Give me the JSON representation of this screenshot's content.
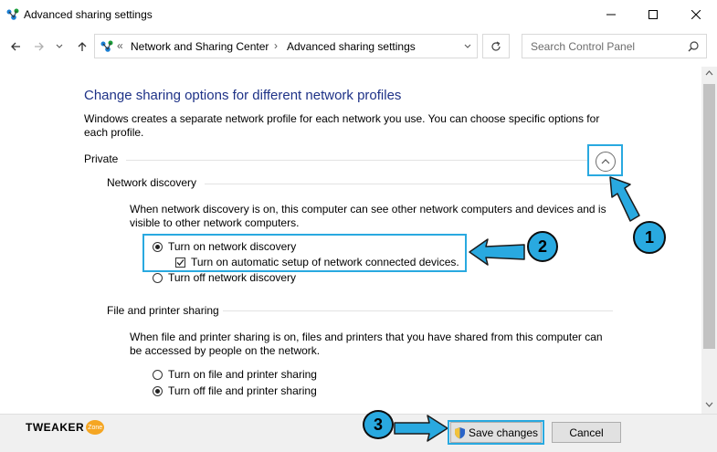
{
  "window": {
    "title": "Advanced sharing settings",
    "app_icon": "network-sharing-icon"
  },
  "address": {
    "chevrons": "«",
    "crumbs": [
      "Network and Sharing Center",
      "Advanced sharing settings"
    ],
    "separator": "›"
  },
  "search": {
    "placeholder": "Search Control Panel"
  },
  "main": {
    "heading": "Change sharing options for different network profiles",
    "intro_line1": "Windows creates a separate network profile for each network you use. You can choose specific options for",
    "intro_line2": "each profile.",
    "profile": "Private",
    "network_discovery": {
      "title": "Network discovery",
      "desc_line1": "When network discovery is on, this computer can see other network computers and devices and is",
      "desc_line2": "visible to other network computers.",
      "opt_on": "Turn on network discovery",
      "opt_auto": "Turn on automatic setup of network connected devices.",
      "opt_off": "Turn off network discovery"
    },
    "file_sharing": {
      "title": "File and printer sharing",
      "desc_line1": "When file and printer sharing is on, files and printers that you have shared from this computer can",
      "desc_line2": "be accessed by people on the network.",
      "opt_on": "Turn on file and printer sharing",
      "opt_off": "Turn off file and printer sharing"
    }
  },
  "annotations": {
    "badge1": "1",
    "badge2": "2",
    "badge3": "3",
    "accent": "#29a9e0"
  },
  "footer": {
    "logo_text": "TWEAKER",
    "logo_sub": "Zone",
    "save": "Save changes",
    "cancel": "Cancel"
  }
}
